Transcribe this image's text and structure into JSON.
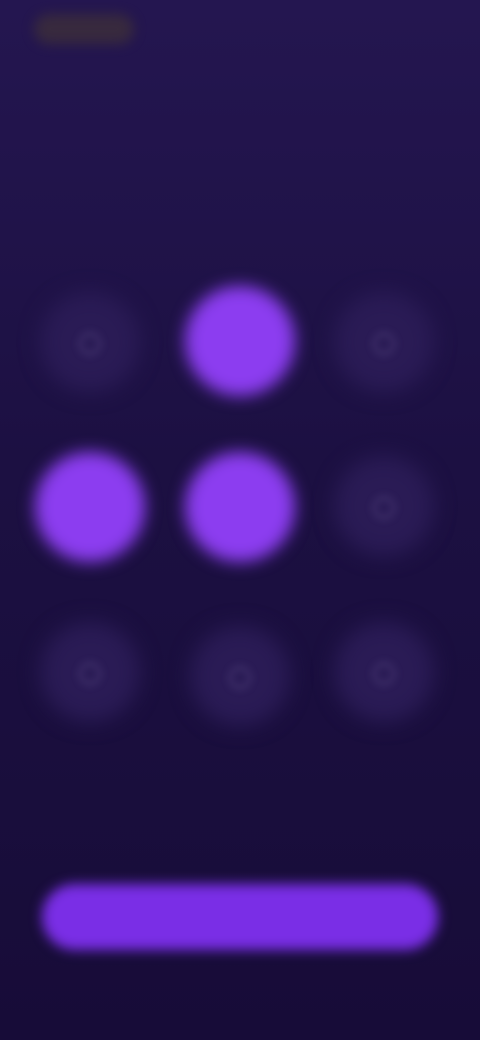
{
  "app": {
    "skip_label": "",
    "title": "",
    "subtitle": ""
  },
  "categories": [
    {
      "label": "",
      "icon": "category-icon",
      "selected": false
    },
    {
      "label": "",
      "icon": "category-icon",
      "selected": true
    },
    {
      "label": "",
      "icon": "category-icon",
      "selected": false
    },
    {
      "label": "",
      "icon": "category-icon",
      "selected": true
    },
    {
      "label": "",
      "icon": "category-icon",
      "selected": true
    },
    {
      "label": "",
      "icon": "category-icon",
      "selected": false
    },
    {
      "label": "",
      "icon": "category-icon",
      "selected": false
    },
    {
      "label": "",
      "icon": "category-icon",
      "selected": false
    },
    {
      "label": "",
      "icon": "category-icon",
      "selected": false
    }
  ],
  "cta": {
    "label": ""
  },
  "footer": {
    "link_label": ""
  },
  "colors": {
    "background": "#1c1042",
    "accent": "#8c3df0",
    "text": "#e8e2f5"
  }
}
